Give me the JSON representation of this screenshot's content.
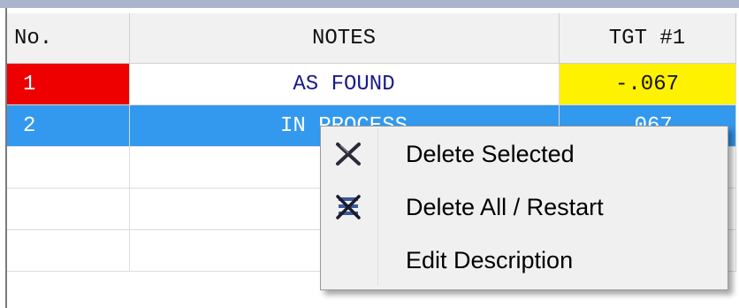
{
  "grid": {
    "columns": [
      "No.",
      "NOTES",
      "TGT #1"
    ],
    "rows": [
      {
        "no": "1",
        "notes": "AS FOUND",
        "tgt": "-.067"
      },
      {
        "no": "2",
        "notes": "IN PROCESS",
        "tgt": ".067"
      },
      {
        "no": "",
        "notes": "",
        "tgt": ""
      },
      {
        "no": "",
        "notes": "",
        "tgt": ""
      },
      {
        "no": "",
        "notes": "",
        "tgt": ""
      }
    ]
  },
  "context_menu": {
    "items": [
      {
        "label": "Delete Selected",
        "icon": "delete-x-icon"
      },
      {
        "label": "Delete All / Restart",
        "icon": "delete-all-icon"
      },
      {
        "label": "Edit Description",
        "icon": ""
      }
    ]
  },
  "colors": {
    "as_found_no": "#ee0000",
    "tgt_highlight": "#fff200",
    "selected_row": "#3399ee",
    "notes_text": "#1a1a8e"
  }
}
